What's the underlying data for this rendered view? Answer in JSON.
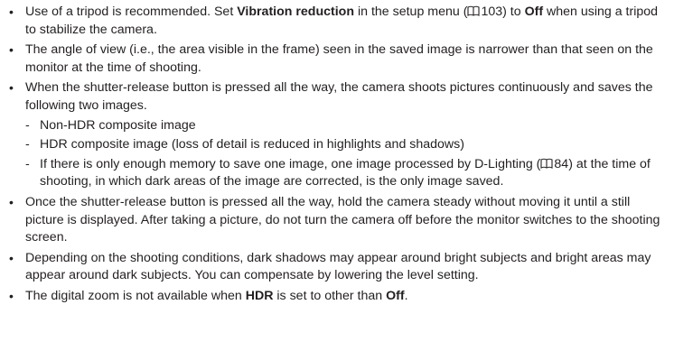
{
  "notes": {
    "tripod": {
      "pre": "Use of a tripod is recommended. Set ",
      "bold1": "Vibration reduction",
      "mid": " in the setup menu (",
      "ref": "103",
      "mid2": ") to ",
      "bold2": "Off",
      "post": " when using a tripod to stabilize the camera."
    },
    "angle": {
      "text": "The angle of view (i.e., the area visible in the frame) seen in the saved image is narrower than that seen on the monitor at the time of shooting."
    },
    "shutter": {
      "text": "When the shutter-release button is pressed all the way, the camera shoots pictures continuously and saves the following two images.",
      "sub1": "Non-HDR composite image",
      "sub2": "HDR composite image (loss of detail is reduced in highlights and shadows)",
      "sub3_pre": "If there is only enough memory to save one image, one image processed by D-Lighting (",
      "sub3_ref": "84",
      "sub3_post": ") at the time of shooting, in which dark areas of the image are corrected, is the only image saved."
    },
    "steady": {
      "text": "Once the shutter-release button is pressed all the way, hold the camera steady without moving it until a still picture is displayed. After taking a picture, do not turn the camera off before the monitor switches to the shooting screen."
    },
    "shadows": {
      "text": "Depending on the shooting conditions, dark shadows may appear around bright subjects and bright areas may appear around dark subjects. You can compensate by lowering the level setting."
    },
    "zoom": {
      "pre": "The digital zoom is not available when ",
      "bold1": "HDR",
      "mid": " is set to other than ",
      "bold2": "Off",
      "post": "."
    },
    "bullet": "•",
    "dash": "-"
  }
}
